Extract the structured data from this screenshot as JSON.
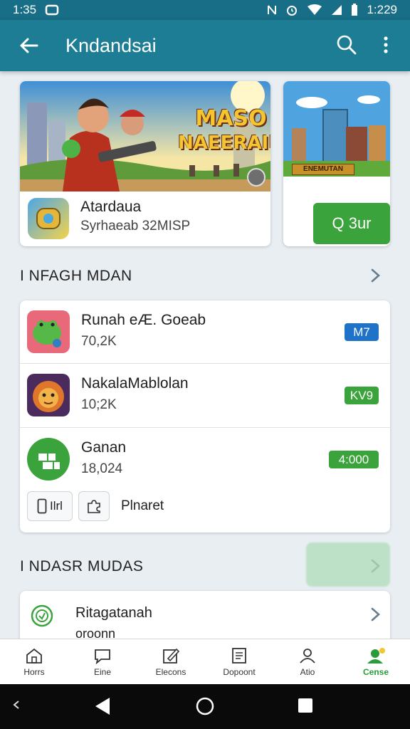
{
  "status_bar": {
    "time_left": "1:35",
    "time_right": "1:229"
  },
  "app_bar": {
    "title": "Kndandsai"
  },
  "featured": [
    {
      "banner_line1": "MASO",
      "banner_line2": "NAEERAIN",
      "name": "Atardaua",
      "subtitle": "Syrhaeab 32MISP"
    },
    {
      "banner_sign": "ENEMUTAN",
      "button_label": "Q 3ur"
    }
  ],
  "section1": {
    "title": "I NFAGH MDAN"
  },
  "list": [
    {
      "name": "Runah eÆ. Goeab",
      "meta": "70,2K",
      "badge": "M7",
      "badge_color": "#1e73c8"
    },
    {
      "name": "NakalaMablolan",
      "meta": "10;2K",
      "badge": "KV9",
      "badge_color": "#3aa33b"
    },
    {
      "name": "Ganan",
      "meta": "18,024",
      "badge": "4:000",
      "badge_color": "#3aa33b"
    }
  ],
  "chips": {
    "chip1": "Ilrl",
    "chip2_label": "Plnaret"
  },
  "section2": {
    "title": "I NDASR MUDAS"
  },
  "bottom_item": {
    "name": "Ritagatanah",
    "sub": "oroonn"
  },
  "bottom_nav": [
    {
      "label": "Horrs",
      "icon": "home-icon"
    },
    {
      "label": "Eine",
      "icon": "chat-icon"
    },
    {
      "label": "Elecons",
      "icon": "edit-icon"
    },
    {
      "label": "Dopoont",
      "icon": "document-icon"
    },
    {
      "label": "Atio",
      "icon": "person-icon"
    },
    {
      "label": "Cense",
      "icon": "profile-badge-icon"
    }
  ],
  "colors": {
    "app_bar": "#1d7d95",
    "accent_green": "#3aa33b",
    "accent_blue": "#1e73c8"
  }
}
